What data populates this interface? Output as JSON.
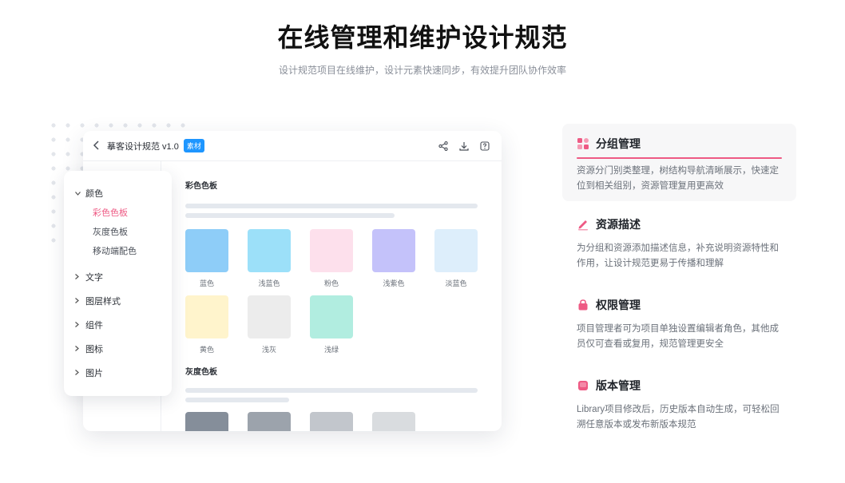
{
  "page": {
    "title": "在线管理和维护设计规范",
    "subtitle": "设计规范项目在线维护，设计元素快速同步，有效提升团队协作效率"
  },
  "window": {
    "back_icon": "chevron-left-icon",
    "title": "摹客设计规范 v1.0",
    "badge": "素材",
    "actions": [
      "share-icon",
      "download-icon",
      "help-icon"
    ]
  },
  "content": {
    "color_section": "彩色色板",
    "color_swatches": [
      {
        "label": "蓝色",
        "color": "#8ecdf8"
      },
      {
        "label": "浅蓝色",
        "color": "#9ce0f9"
      },
      {
        "label": "粉色",
        "color": "#fde0ec"
      },
      {
        "label": "浅紫色",
        "color": "#c4c2fa"
      },
      {
        "label": "淡蓝色",
        "color": "#ddeefb"
      },
      {
        "label": "黄色",
        "color": "#fff4cc"
      },
      {
        "label": "浅灰",
        "color": "#ececec"
      },
      {
        "label": "浅绿",
        "color": "#b1ede0"
      }
    ],
    "gray_section": "灰度色板",
    "gray_swatches": [
      {
        "color": "#858e9a"
      },
      {
        "color": "#9ca3ac"
      },
      {
        "color": "#c2c6cc"
      },
      {
        "color": "#d9dcdf"
      }
    ]
  },
  "tree": {
    "expanded": {
      "label": "颜色",
      "children": [
        {
          "label": "彩色色板",
          "active": true
        },
        {
          "label": "灰度色板",
          "active": false
        },
        {
          "label": "移动端配色",
          "active": false
        }
      ]
    },
    "collapsed": [
      "文字",
      "图层样式",
      "组件",
      "图标",
      "图片"
    ]
  },
  "features": [
    {
      "icon": "grid-icon",
      "title": "分组管理",
      "desc": "资源分门别类整理，树结构导航清晰展示，快速定位到相关组别，资源管理复用更高效",
      "active": true
    },
    {
      "icon": "pencil-icon",
      "title": "资源描述",
      "desc": "为分组和资源添加描述信息，补充说明资源特性和作用，让设计规范更易于传播和理解",
      "active": false
    },
    {
      "icon": "lock-icon",
      "title": "权限管理",
      "desc": "项目管理者可为项目单独设置编辑者角色，其他成员仅可查看或复用，规范管理更安全",
      "active": false
    },
    {
      "icon": "version-icon",
      "title": "版本管理",
      "desc": "Library项目修改后，历史版本自动生成，可轻松回溯任意版本或发布新版本规范",
      "active": false
    }
  ],
  "colors": {
    "accent": "#ee5a84",
    "badge": "#1e96ff"
  }
}
